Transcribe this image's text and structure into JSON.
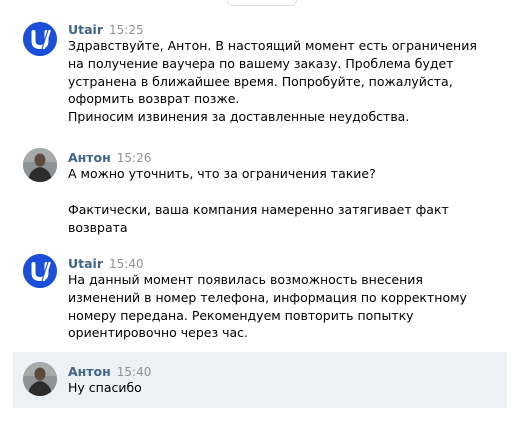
{
  "messages": [
    {
      "author": "Utair",
      "time": "15:25",
      "avatar_icon": "utair-logo-icon",
      "paragraphs": [
        "Здравствуйте, Антон. В настоящий момент есть ограничения",
        "на получение ваучера по вашему заказу. Проблема будет",
        "устранена в ближайшее время. Попробуйте, пожалуйста,",
        "оформить возврат позже.",
        "Приносим извинения за доставленные неудобства."
      ]
    },
    {
      "author": "Антон",
      "time": "15:26",
      "avatar_icon": "user-photo-icon",
      "paragraphs": [
        "А можно уточнить, что за ограничения такие?",
        "Фактически, ваша компания намеренно затягивает факт",
        "возврата"
      ]
    },
    {
      "author": "Utair",
      "time": "15:40",
      "avatar_icon": "utair-logo-icon",
      "paragraphs": [
        "На данный момент появилась возможность внесения",
        "изменений в номер телефона, информация по корректному",
        "номеру передана. Рекомендуем повторить попытку",
        "ориентировочно через час."
      ]
    },
    {
      "author": "Антон",
      "time": "15:40",
      "avatar_icon": "user-photo-icon",
      "paragraphs": [
        "Ну спасибо"
      ]
    }
  ],
  "colors": {
    "author": "#42648b",
    "time": "#939393",
    "highlight": "#edf0f5",
    "utair_blue": "#1b4fd8"
  }
}
